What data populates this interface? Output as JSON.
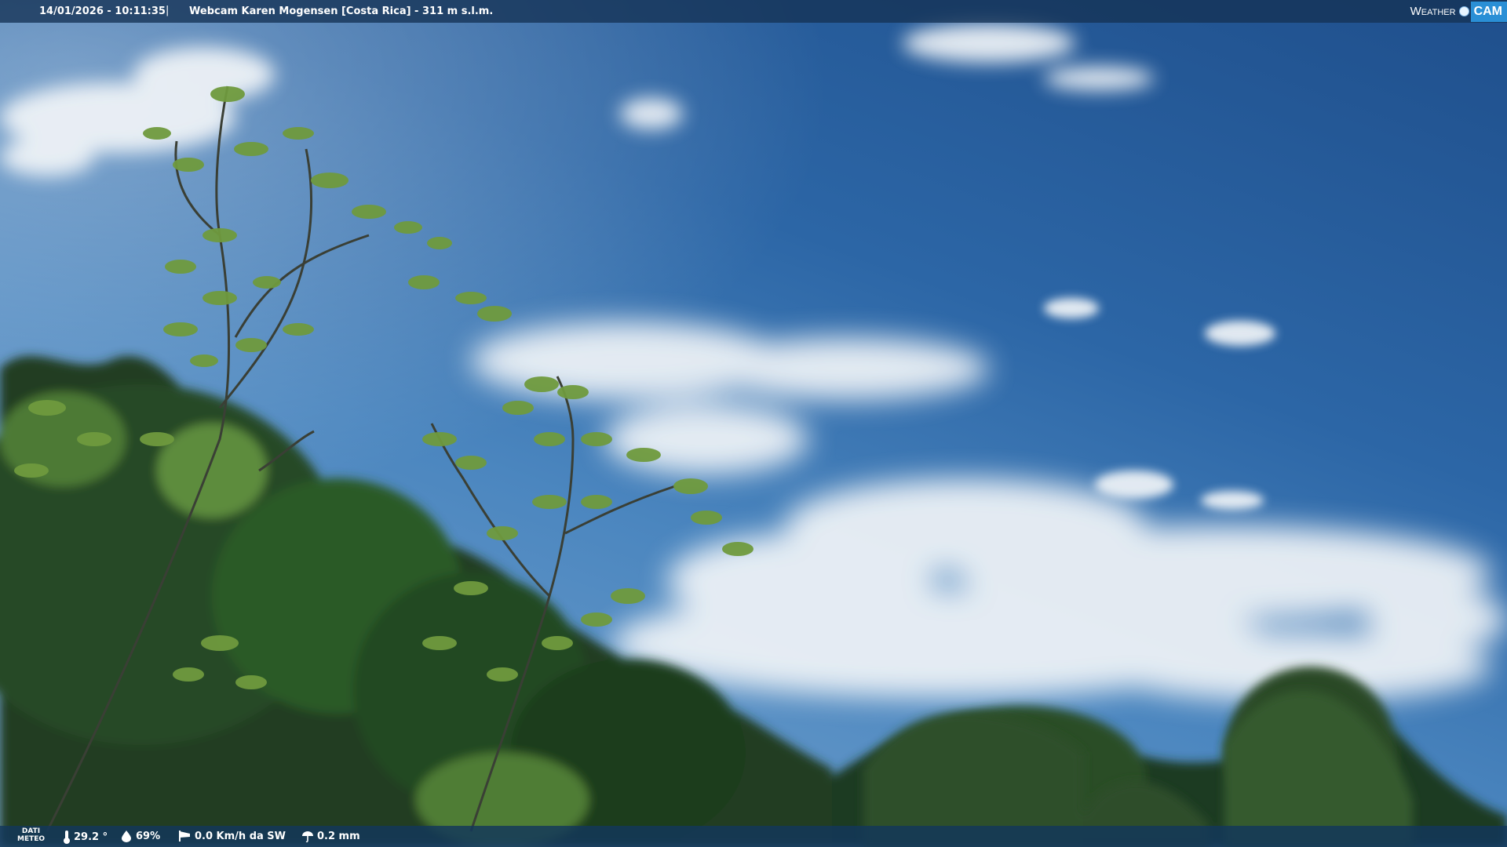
{
  "header": {
    "timestamp": "14/01/2026 - 10:11:35",
    "separator": "|",
    "title": "Webcam Karen Mogensen [Costa Rica] - 311 m s.l.m.",
    "brand_weather": "Weather",
    "brand_cam": "CAM"
  },
  "weather": {
    "label_line1": "DATI",
    "label_line2": "METEO",
    "temperature": "29.2 °",
    "humidity": "69%",
    "wind": "0.0 Km/h da SW",
    "rain": "0.2 mm"
  },
  "icons": {
    "temperature": "thermometer-icon",
    "humidity": "drop-icon",
    "wind": "windsock-icon",
    "rain": "umbrella-icon"
  },
  "colors": {
    "sky_top": "#1f4f8c",
    "sky_bottom": "#7eaad2",
    "bar": "#14325a",
    "brand_accent": "#2a8fd6"
  }
}
